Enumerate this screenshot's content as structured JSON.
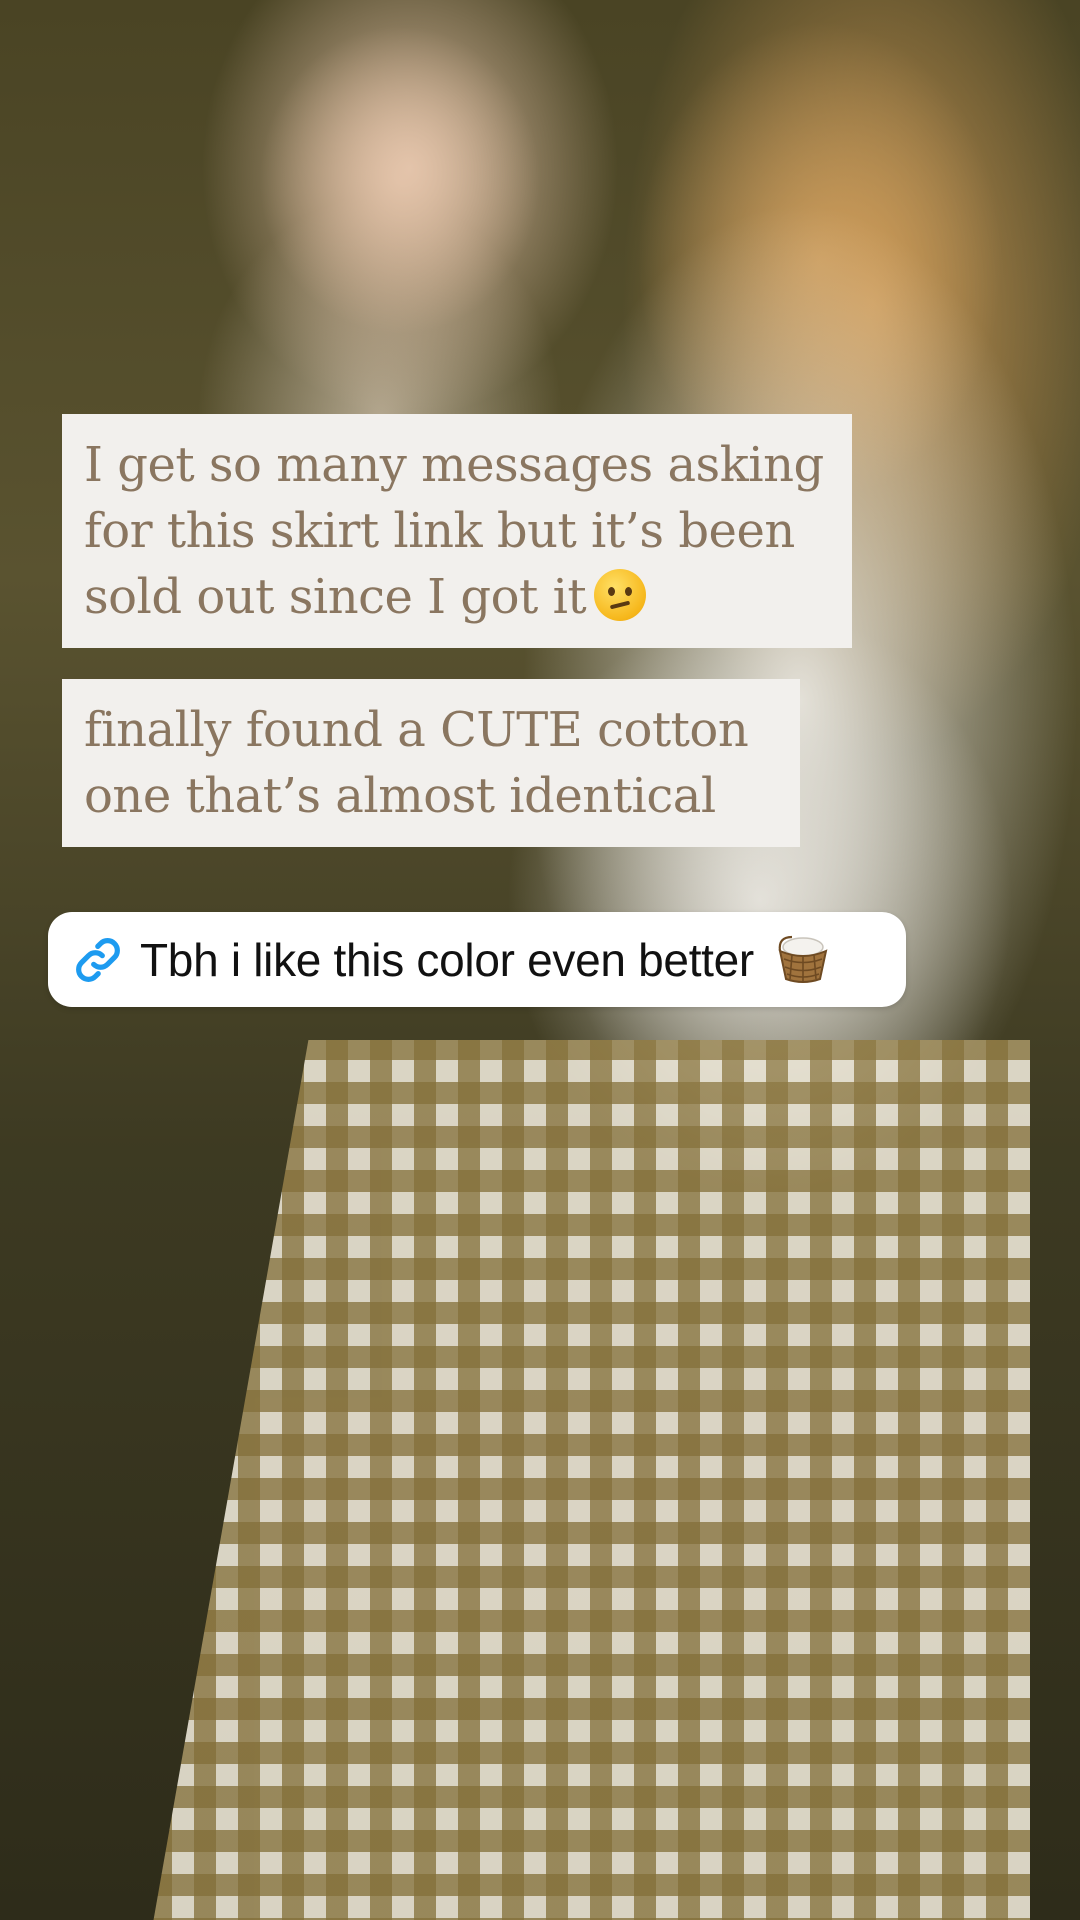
{
  "story": {
    "captions": [
      {
        "lines": [
          "I get so many messages asking",
          "for this skirt link but it’s been",
          "sold out since I got it"
        ],
        "trailing_emoji": "confused-face-emoji"
      },
      {
        "lines": [
          "finally found a CUTE cotton",
          "one that’s almost identical"
        ]
      }
    ],
    "link_sticker": {
      "icon": "link-icon",
      "label": "Tbh i like this color even better",
      "trailing_emoji": "basket-emoji"
    }
  },
  "colors": {
    "caption_background": "#f2f0ed",
    "caption_text": "#8a7660",
    "link_icon": "#1d9bf0",
    "link_text": "#111111",
    "sticker_background": "#ffffff"
  }
}
